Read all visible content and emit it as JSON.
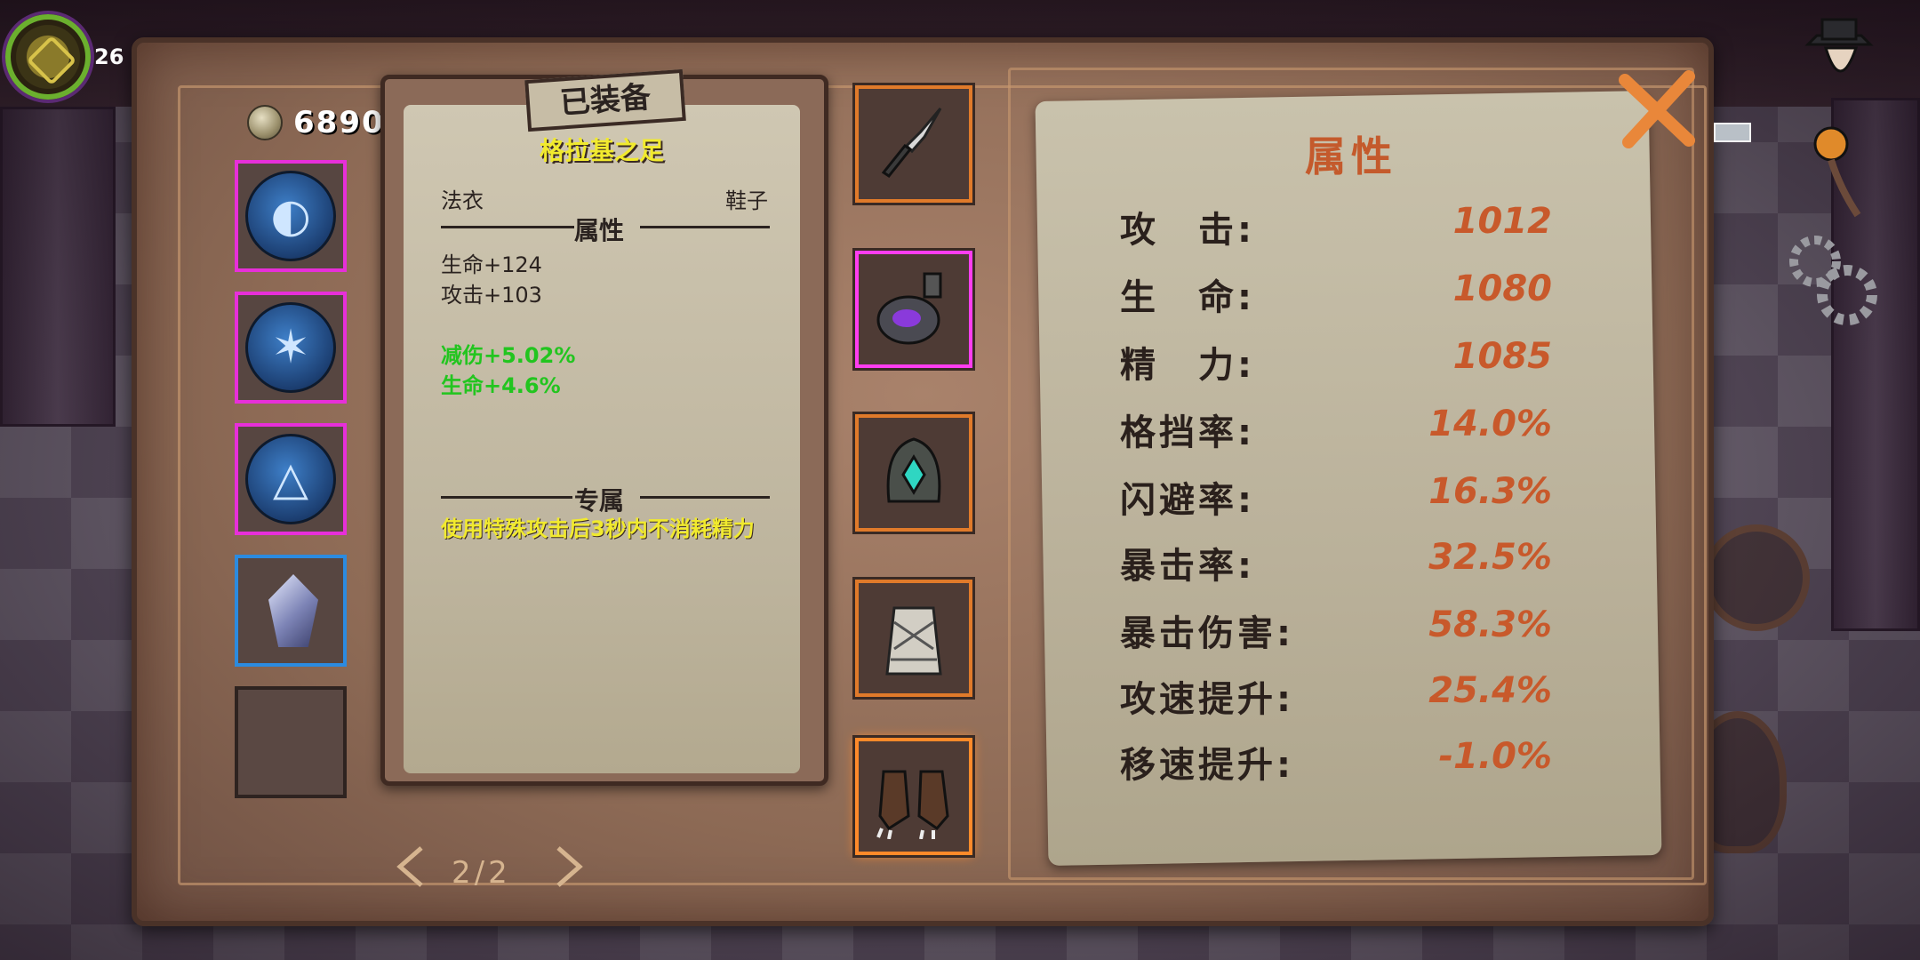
{
  "hud": {
    "level": "26"
  },
  "currency": {
    "icon": "coin-icon",
    "amount": "6890"
  },
  "inventory": {
    "slots": [
      {
        "icon": "half-circle-rune-icon",
        "rarity": "epic"
      },
      {
        "icon": "burst-rune-icon",
        "rarity": "epic"
      },
      {
        "icon": "triangle-rune-icon",
        "rarity": "epic"
      },
      {
        "icon": "crystal-shard-icon",
        "rarity": "rare"
      },
      {
        "icon": "",
        "rarity": "empty"
      }
    ]
  },
  "detail": {
    "tag": "已装备",
    "item_name": "格拉基之足",
    "category": "法衣",
    "slot_type": "鞋子",
    "attributes_title": "属性",
    "base_stats": [
      "生命+124",
      "攻击+103"
    ],
    "bonus_stats": [
      "减伤+5.02%",
      "生命+4.6%"
    ],
    "exclusive_title": "专属",
    "exclusive_text": "使用特殊攻击后3秒内不消耗精力"
  },
  "gear_slots": [
    {
      "name": "dagger-icon"
    },
    {
      "name": "potion-flask-icon"
    },
    {
      "name": "hood-helmet-icon"
    },
    {
      "name": "bandage-armor-icon"
    },
    {
      "name": "claw-boots-icon"
    }
  ],
  "attributes": {
    "title": "属性",
    "rows": [
      {
        "label": "攻　击:",
        "value": "1012"
      },
      {
        "label": "生　命:",
        "value": "1080"
      },
      {
        "label": "精　力:",
        "value": "1085"
      },
      {
        "label": "格挡率:",
        "value": "14.0%"
      },
      {
        "label": "闪避率:",
        "value": "16.3%"
      },
      {
        "label": "暴击率:",
        "value": "32.5%"
      },
      {
        "label": "暴击伤害:",
        "value": "58.3%"
      },
      {
        "label": "攻速提升:",
        "value": "25.4%"
      },
      {
        "label": "移速提升:",
        "value": "-1.0%"
      }
    ]
  },
  "pagination": {
    "text": "2/2"
  },
  "colors": {
    "epic_border": "#e72fd9",
    "rare_border": "#2b8be0",
    "value_orange": "#c8592b",
    "bonus_green": "#22c51f",
    "exclusive_yellow": "#f1ea2e"
  }
}
